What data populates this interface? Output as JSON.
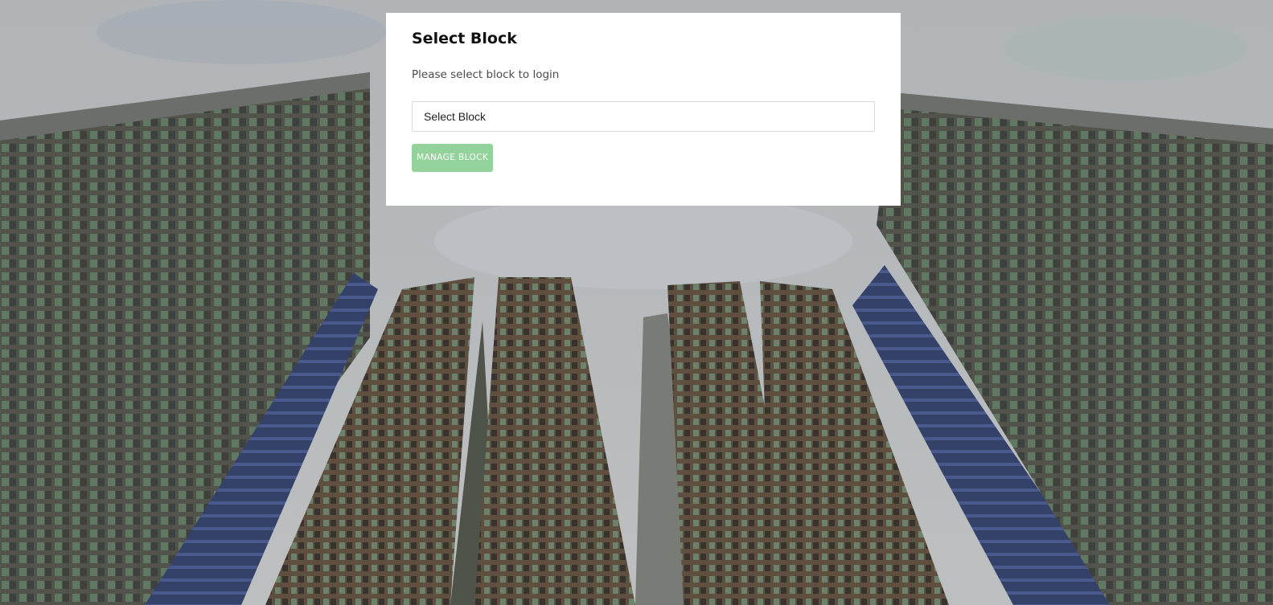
{
  "card": {
    "title": "Select Block",
    "subtitle": "Please select block to login",
    "select_value": "Select Block",
    "button_label": "MANAGE BLOCK"
  },
  "colors": {
    "button_bg": "#93d39b",
    "card_bg": "#ffffff"
  }
}
